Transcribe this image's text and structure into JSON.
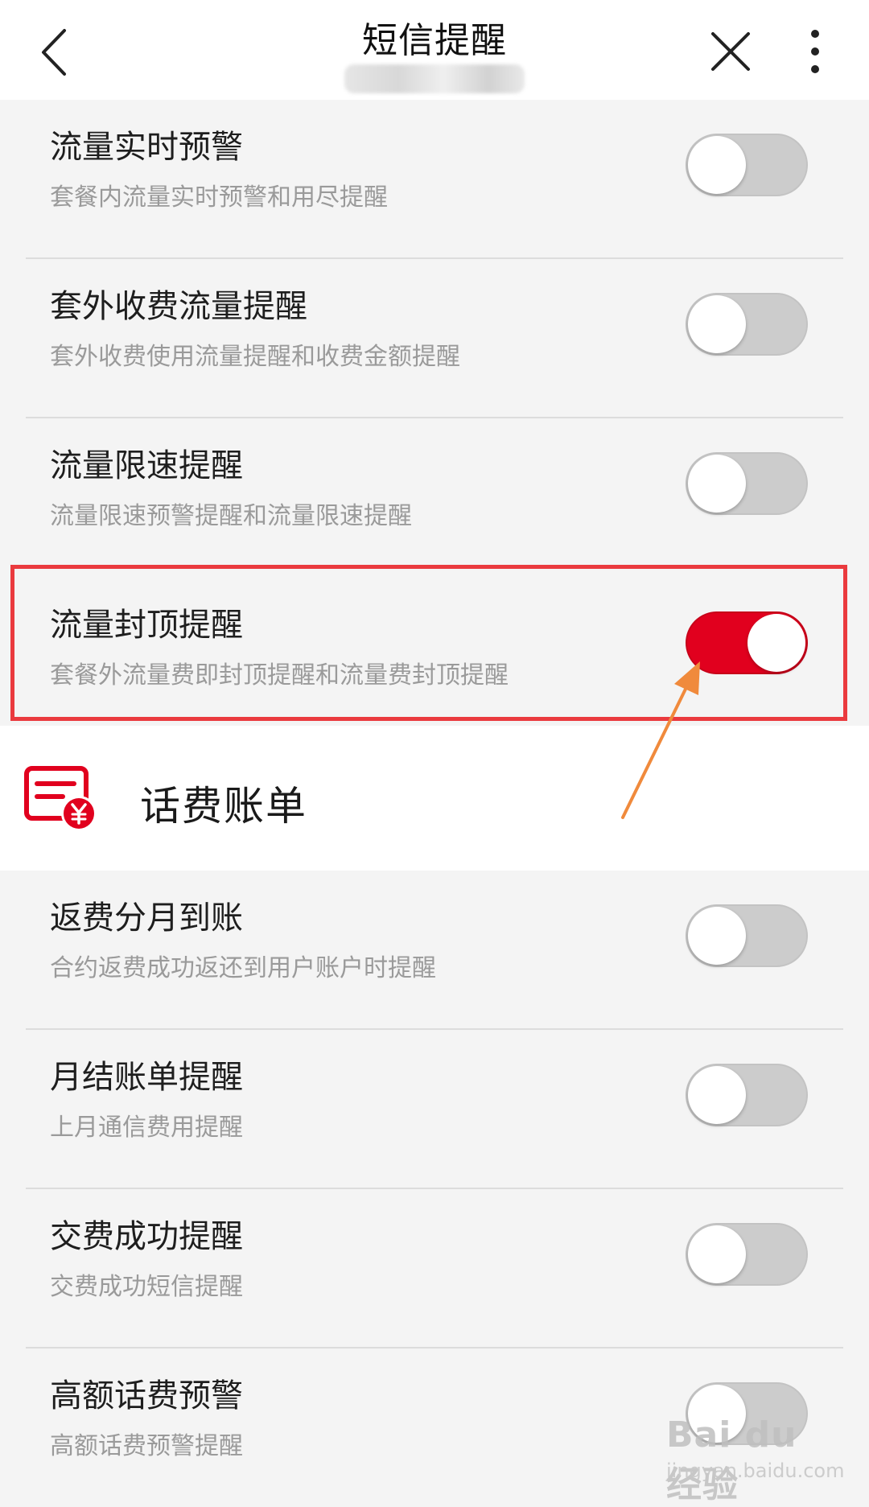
{
  "header": {
    "title": "短信提醒"
  },
  "rows_flow": [
    {
      "title": "流量实时预警",
      "desc": "套餐内流量实时预警和用尽提醒",
      "on": false
    },
    {
      "title": "套外收费流量提醒",
      "desc": "套外收费使用流量提醒和收费金额提醒",
      "on": false
    },
    {
      "title": "流量限速提醒",
      "desc": "流量限速预警提醒和流量限速提醒",
      "on": false
    },
    {
      "title": "流量封顶提醒",
      "desc": "套餐外流量费即封顶提醒和流量费封顶提醒",
      "on": true
    }
  ],
  "section": {
    "title": "话费账单",
    "icon": "bill-yuan-icon"
  },
  "rows_bill": [
    {
      "title": "返费分月到账",
      "desc": "合约返费成功返还到用户账户时提醒",
      "on": false
    },
    {
      "title": "月结账单提醒",
      "desc": "上月通信费用提醒",
      "on": false
    },
    {
      "title": "交费成功提醒",
      "desc": "交费成功短信提醒",
      "on": false
    },
    {
      "title": "高额话费预警",
      "desc": "高额话费预警提醒",
      "on": false
    }
  ],
  "colors": {
    "accent": "#e1001e",
    "toggle_off": "#cccccc",
    "highlight": "#ea3a3e",
    "arrow": "#f08a3c"
  },
  "watermark": {
    "logo": "Bai du 经验",
    "sub": "jingyan.baidu.com"
  }
}
